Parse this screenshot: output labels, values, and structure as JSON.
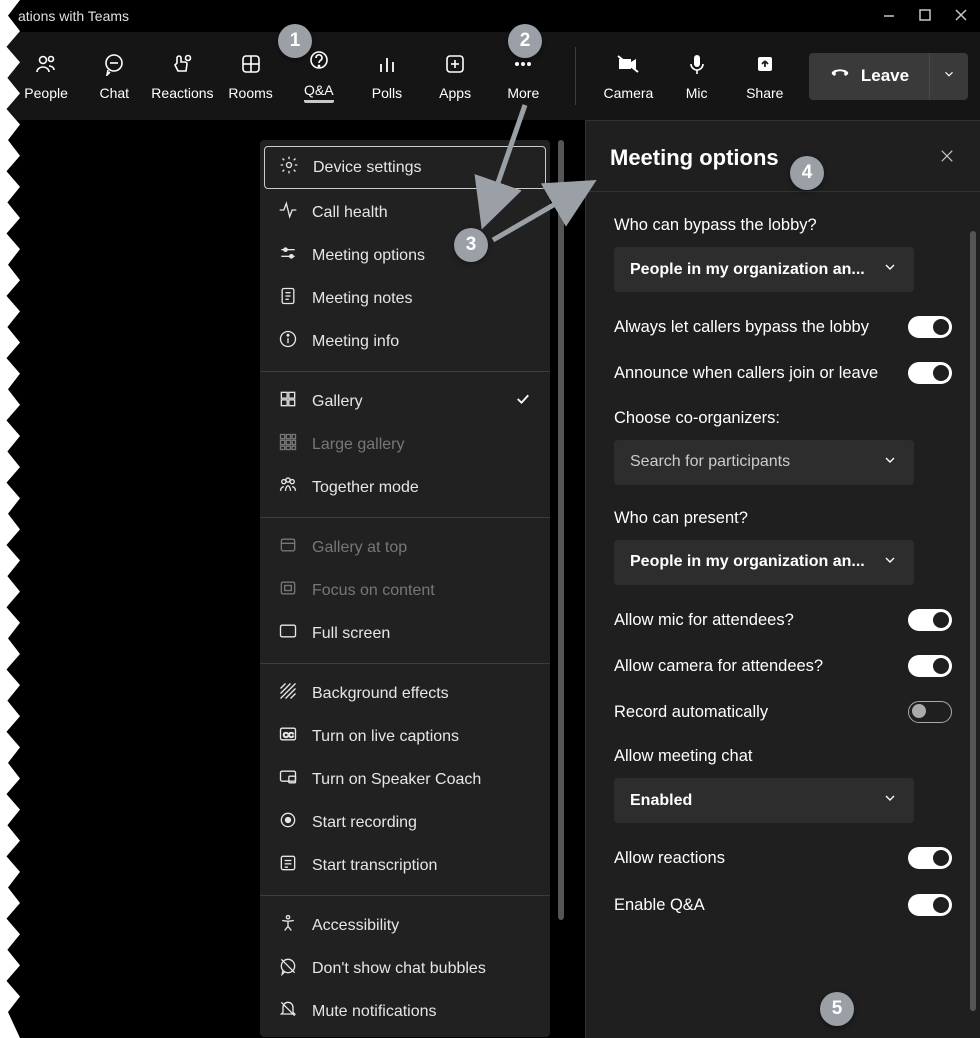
{
  "titlebar": {
    "title": "ations with Teams"
  },
  "toolbar": {
    "items": [
      {
        "id": "people",
        "label": "People"
      },
      {
        "id": "chat",
        "label": "Chat"
      },
      {
        "id": "reactions",
        "label": "Reactions"
      },
      {
        "id": "rooms",
        "label": "Rooms"
      },
      {
        "id": "qa",
        "label": "Q&A",
        "active": true
      },
      {
        "id": "polls",
        "label": "Polls"
      },
      {
        "id": "apps",
        "label": "Apps"
      },
      {
        "id": "more",
        "label": "More"
      }
    ],
    "right": {
      "camera": "Camera",
      "mic": "Mic",
      "share": "Share"
    },
    "leave": "Leave"
  },
  "more_menu": {
    "sections": [
      [
        {
          "id": "device-settings",
          "label": "Device settings",
          "icon": "gear",
          "selected": true
        },
        {
          "id": "call-health",
          "label": "Call health",
          "icon": "pulse"
        },
        {
          "id": "meeting-options",
          "label": "Meeting options",
          "icon": "sliders"
        },
        {
          "id": "meeting-notes",
          "label": "Meeting notes",
          "icon": "notes"
        },
        {
          "id": "meeting-info",
          "label": "Meeting info",
          "icon": "info"
        }
      ],
      [
        {
          "id": "gallery",
          "label": "Gallery",
          "icon": "grid",
          "checked": true
        },
        {
          "id": "large-gallery",
          "label": "Large gallery",
          "icon": "grid3",
          "dim": true
        },
        {
          "id": "together-mode",
          "label": "Together mode",
          "icon": "people-group"
        }
      ],
      [
        {
          "id": "gallery-top",
          "label": "Gallery at top",
          "icon": "top-panel",
          "dim": true
        },
        {
          "id": "focus-content",
          "label": "Focus on content",
          "icon": "focus",
          "dim": true
        },
        {
          "id": "full-screen",
          "label": "Full screen",
          "icon": "fullscreen"
        }
      ],
      [
        {
          "id": "background-effects",
          "label": "Background effects",
          "icon": "bg"
        },
        {
          "id": "live-captions",
          "label": "Turn on live captions",
          "icon": "cc"
        },
        {
          "id": "speaker-coach",
          "label": "Turn on Speaker Coach",
          "icon": "coach"
        },
        {
          "id": "start-recording",
          "label": "Start recording",
          "icon": "record"
        },
        {
          "id": "start-transcription",
          "label": "Start transcription",
          "icon": "transcript"
        }
      ],
      [
        {
          "id": "accessibility",
          "label": "Accessibility",
          "icon": "accessibility"
        },
        {
          "id": "no-chat-bubbles",
          "label": "Don't show chat bubbles",
          "icon": "no-bubble"
        },
        {
          "id": "mute-notifications",
          "label": "Mute notifications",
          "icon": "bell-off"
        }
      ]
    ]
  },
  "panel": {
    "title": "Meeting options",
    "lobby_label": "Who can bypass the lobby?",
    "lobby_value": "People in my organization an...",
    "always_bypass_label": "Always let callers bypass the lobby",
    "always_bypass": true,
    "announce_label": "Announce when callers join or leave",
    "announce": true,
    "coorg_label": "Choose co-organizers:",
    "coorg_placeholder": "Search for participants",
    "present_label": "Who can present?",
    "present_value": "People in my organization an...",
    "allow_mic_label": "Allow mic for attendees?",
    "allow_mic": true,
    "allow_cam_label": "Allow camera for attendees?",
    "allow_cam": true,
    "record_auto_label": "Record automatically",
    "record_auto": false,
    "chat_label": "Allow meeting chat",
    "chat_value": "Enabled",
    "reactions_label": "Allow reactions",
    "reactions": true,
    "qa_label": "Enable Q&A",
    "qa": true
  },
  "callouts": {
    "1": "1",
    "2": "2",
    "3": "3",
    "4": "4",
    "5": "5"
  }
}
